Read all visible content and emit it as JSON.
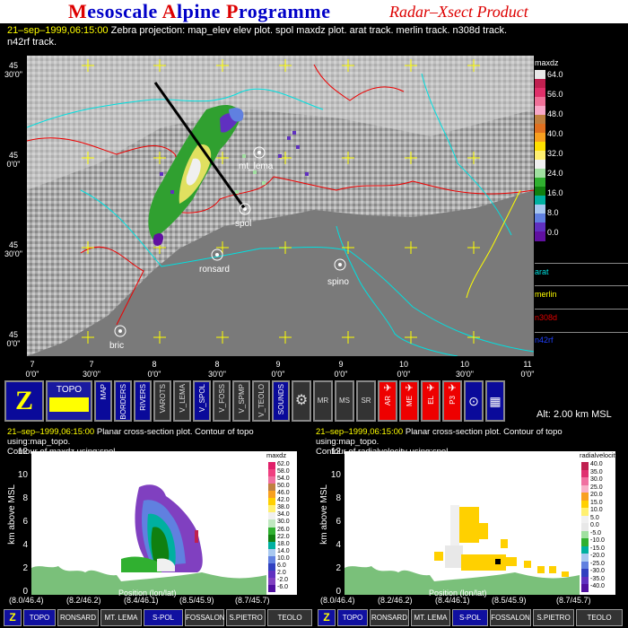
{
  "banner": {
    "title_parts": [
      "M",
      "esoscale ",
      "A",
      "lpine ",
      "P",
      "rogramme"
    ],
    "subtitle": "Radar–Xsect Product"
  },
  "header": {
    "date": "21–sep–1999,06:15:00",
    "line1": "Zebra projection: map_elev elev plot.  spol maxdz  plot.   arat track.   merlin track.   n308d track.",
    "line2": "n42rf track."
  },
  "map": {
    "lat_labels": [
      "45\n30'0\"",
      "45\n0'0\"",
      "45\n30'0\"",
      "45\n0'0\""
    ],
    "lon_labels": [
      "7\n0'0\"",
      "7\n30'0\"",
      "8\n0'0\"",
      "8\n30'0\"",
      "9\n0'0\"",
      "9\n0'0\"",
      "10\n0'0\"",
      "10\n30'0\"",
      "11\n0'0\""
    ],
    "stations": [
      "mt_lema",
      "spol",
      "ronsard",
      "spino",
      "bric"
    ]
  },
  "colorbar": {
    "title": "maxdz",
    "labels": [
      "64.0",
      "56.0",
      "48.0",
      "40.0",
      "32.0",
      "24.0",
      "16.0",
      "8.0",
      "0.0"
    ],
    "colors": [
      "#e8e8e8",
      "#c02050",
      "#e0306a",
      "#f07098",
      "#f8a8c8",
      "#c08040",
      "#e07020",
      "#f8a020",
      "#ffe000",
      "#fff070",
      "#f0f0f0",
      "#a0e0a0",
      "#30b030",
      "#108010",
      "#00b0a0",
      "#a8c8f0",
      "#6080e0",
      "#6030c0",
      "#6010a0"
    ]
  },
  "tracks": [
    {
      "name": "arat",
      "color": "#00e0e0"
    },
    {
      "name": "merlin",
      "color": "#ffff00"
    },
    {
      "name": "n308d",
      "color": "#e00000"
    },
    {
      "name": "n42rf",
      "color": "#2040ff"
    }
  ],
  "toolbar": {
    "buttons": [
      "Z",
      "TOPO",
      "MAP",
      "BORDERS",
      "RIVERS",
      "VAROTS",
      "V_LEMA",
      "V_SPOL",
      "V_FOSS",
      "V_SPMP",
      "V_TEOLO",
      "SOUNDS",
      "⚙",
      "MR",
      "MS",
      "SR",
      "AR",
      "ME",
      "EL",
      "P3",
      "⊙",
      "▦"
    ]
  },
  "altitude": "Alt: 2.00 km MSL",
  "panel_left": {
    "line1_rest": "  Planar cross-section plot.  Contour of topo using:map_topo.",
    "line2": "Contour of maxdz using:spol.",
    "cb_title": "maxdz",
    "cb_labels": [
      "62.0",
      "58.0",
      "54.0",
      "50.0",
      "46.0",
      "42.0",
      "38.0",
      "34.0",
      "30.0",
      "26.0",
      "22.0",
      "18.0",
      "14.0",
      "10.0",
      "6.0",
      "2.0",
      "-2.0",
      "-6.0"
    ]
  },
  "panel_right": {
    "line1_rest": "  Planar cross-section plot.  Contour of topo using:map_topo.",
    "line2": "Contour of radialvelocity using:spol.",
    "cb_title": "radialvelocity",
    "cb_labels": [
      "40.0",
      "35.0",
      "30.0",
      "25.0",
      "20.0",
      "15.0",
      "10.0",
      "5.0",
      "0.0",
      "-5.0",
      "-10.0",
      "-15.0",
      "-20.0",
      "-25.0",
      "-30.0",
      "-35.0",
      "-40.0"
    ]
  },
  "ylabel": "km above MSL",
  "xlabel": "Position (lon/lat)",
  "yticks": [
    "12",
    "10",
    "8",
    "6",
    "4",
    "2",
    "0"
  ],
  "xticks": [
    "(8.0/46.4)",
    "(8.2/46.2)",
    "(8.4/46.1)",
    "(8.5/45.9)",
    "(8.7/45.7)"
  ],
  "bottom_buttons": [
    "Z",
    "TOPO",
    "RONSARD",
    "MT. LEMA",
    "S-POL",
    "FOSSALON",
    "S.PIETRO",
    "TEOLO"
  ]
}
